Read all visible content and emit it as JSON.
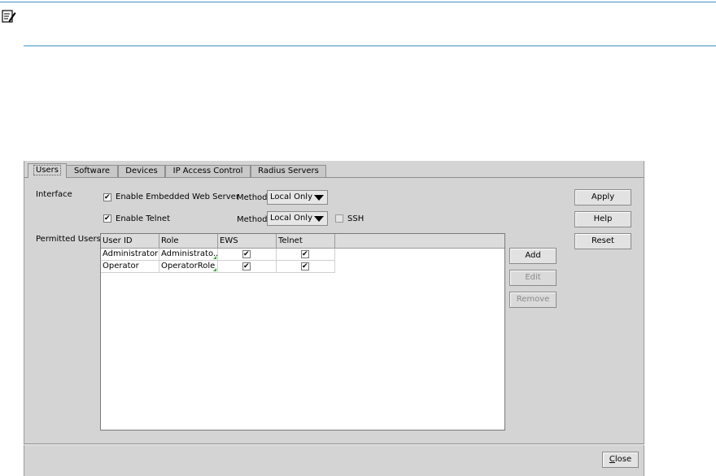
{
  "note_icon": "note-pencil-icon",
  "tabs": [
    {
      "label": "Users",
      "active": true
    },
    {
      "label": "Software",
      "active": false
    },
    {
      "label": "Devices",
      "active": false
    },
    {
      "label": "IP Access Control",
      "active": false
    },
    {
      "label": "Radius Servers",
      "active": false
    }
  ],
  "interface": {
    "label": "Interface",
    "ews": {
      "label": "Enable Embedded Web Server",
      "checked": true,
      "method_label": "Method",
      "method_value": "Local Only"
    },
    "telnet": {
      "label": "Enable Telnet",
      "checked": true,
      "method_label": "Method",
      "method_value": "Local Only"
    },
    "ssh": {
      "label": "SSH",
      "checked": false
    }
  },
  "permitted_users": {
    "label": "Permitted Users",
    "columns": [
      "User ID",
      "Role",
      "EWS",
      "Telnet"
    ],
    "rows": [
      {
        "user_id": "Administrator",
        "role": "Administrato...",
        "ews": true,
        "telnet": true
      },
      {
        "user_id": "Operator",
        "role": "OperatorRole",
        "ews": true,
        "telnet": true
      }
    ]
  },
  "table_buttons": {
    "add": "Add",
    "edit": "Edit",
    "remove": "Remove"
  },
  "side_buttons": {
    "apply": "Apply",
    "help": "Help",
    "reset": "Reset"
  },
  "close": {
    "label_first": "C",
    "label_rest": "lose"
  },
  "colors": {
    "accent_line": "#3b93c7",
    "panel_bg": "#d4d4d4",
    "flag_green": "#33aa33"
  }
}
